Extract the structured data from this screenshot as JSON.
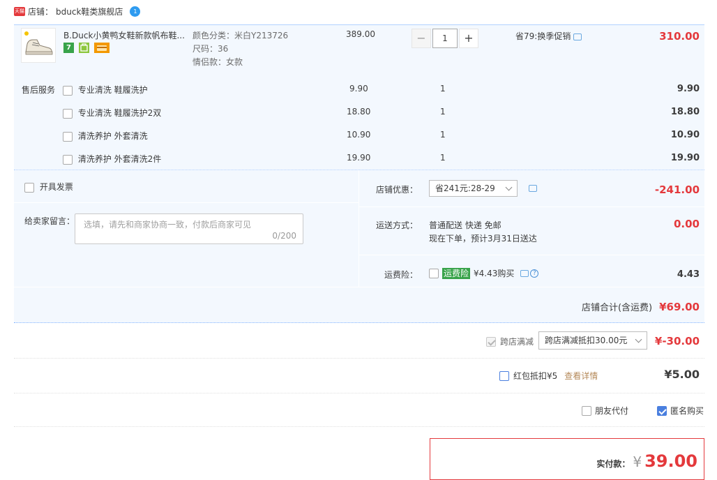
{
  "shop": {
    "badge": "天猫",
    "label": "店铺：",
    "name": "bduck鞋类旗舰店",
    "chat_badge": "1"
  },
  "item": {
    "title": "B.Duck小黄鸭女鞋新款帆布鞋...",
    "badge_7": "7",
    "sku": [
      "颜色分类：米白Y213726",
      "尺码：36",
      "情侣款：女款"
    ],
    "unit_price": "389.00",
    "quantity": "1",
    "qty_minus": "−",
    "qty_plus": "+",
    "promo": "省79:换季促销",
    "subtotal": "310.00"
  },
  "services": {
    "label": "售后服务",
    "items": [
      {
        "name": "专业清洗 鞋履洗护",
        "price": "9.90",
        "qty": "1",
        "total": "9.90"
      },
      {
        "name": "专业清洗 鞋履洗护2双",
        "price": "18.80",
        "qty": "1",
        "total": "18.80"
      },
      {
        "name": "清洗养护 外套清洗",
        "price": "10.90",
        "qty": "1",
        "total": "10.90"
      },
      {
        "name": "清洗养护 外套清洗2件",
        "price": "19.90",
        "qty": "1",
        "total": "19.90"
      }
    ]
  },
  "invoice": {
    "label": "开具发票"
  },
  "remark": {
    "label": "给卖家留言：",
    "placeholder": "选填，请先和商家协商一致，付款后商家可见",
    "counter": "0/200"
  },
  "shop_discount": {
    "label": "店铺优惠：",
    "selected": "省241元:28-29",
    "amount": "-241.00"
  },
  "shipping": {
    "label": "运送方式：",
    "method": "普通配送 快递 免邮",
    "eta": "现在下单，预计3月31日送达",
    "amount": "0.00"
  },
  "insurance": {
    "label": "运费险：",
    "tag": "运费险",
    "price": "¥4.43购买",
    "amount": "4.43"
  },
  "shop_total": {
    "label": "店铺合计(含运费)",
    "amount": "¥69.00"
  },
  "cross_store": {
    "label": "跨店满减",
    "selected": "跨店满减抵扣30.00元",
    "amount": "¥-30.00"
  },
  "red_packet": {
    "label": "红包抵扣¥5",
    "link": "查看详情",
    "amount": "¥5.00"
  },
  "options": {
    "friend_pay": "朋友代付",
    "anonymous": "匿名购买"
  },
  "payment": {
    "label": "实付款：",
    "currency": "¥",
    "amount": "39.00"
  },
  "colors": {
    "accent_red": "#e4393c",
    "item_bg": "#f3f8fe",
    "checkbox_blue": "#4a7fdf",
    "link_orange": "#b58a5a"
  }
}
